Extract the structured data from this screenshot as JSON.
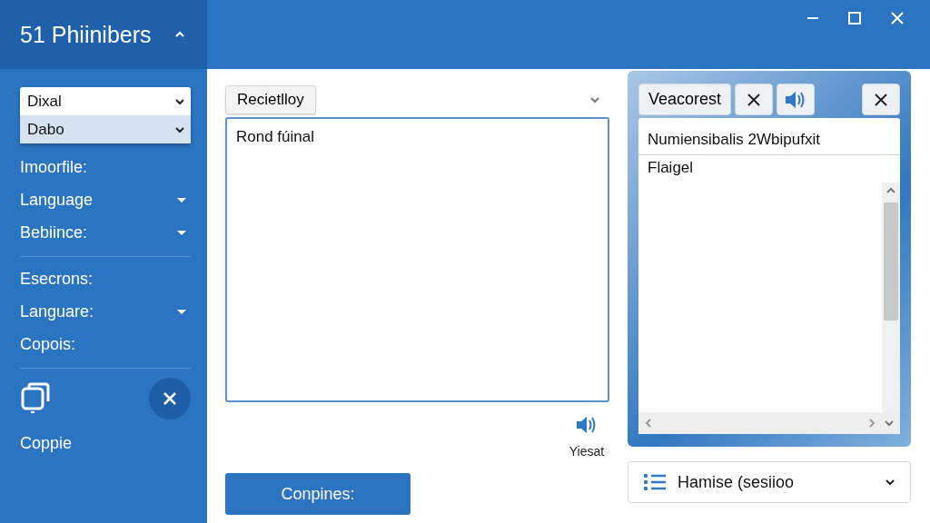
{
  "sidebar": {
    "title": "51 Phiinibers",
    "pickers": [
      {
        "value": "Dixal",
        "selected": false
      },
      {
        "value": "Dabo",
        "selected": true
      }
    ],
    "sections": [
      [
        {
          "kind": "label",
          "text": "Imoorfile:"
        },
        {
          "kind": "dropdown",
          "text": "Language"
        },
        {
          "kind": "dropdown",
          "text": "Bebiince:"
        }
      ],
      [
        {
          "kind": "label",
          "text": "Esecrons:"
        },
        {
          "kind": "dropdown",
          "text": "Languare:"
        },
        {
          "kind": "label",
          "text": "Copois:"
        }
      ]
    ],
    "action_label": "Coppie"
  },
  "editor": {
    "tab": "Recietlloy",
    "value": "Rond fúinal",
    "speak_label": "Yiesat",
    "button": "Conpines:"
  },
  "panel": {
    "tab": "Veacorest",
    "lines": [
      "Numiensibalis 2Wbipufxit",
      "Flaigel"
    ],
    "dropdown": "Hamise (sesiioo"
  }
}
